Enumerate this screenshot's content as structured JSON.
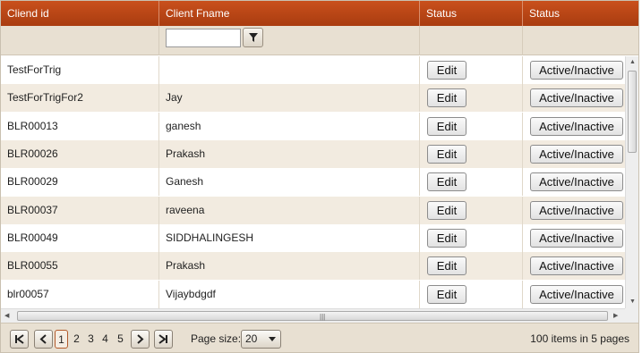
{
  "columns": [
    {
      "label": "Cliend id"
    },
    {
      "label": "Client Fname"
    },
    {
      "label": "Status"
    },
    {
      "label": "Status"
    }
  ],
  "filter": {
    "value": ""
  },
  "icons": {
    "filter": "filter-funnel-icon",
    "first": "first-page-icon",
    "prev": "prev-page-icon",
    "next": "next-page-icon",
    "last": "last-page-icon"
  },
  "rows": [
    {
      "id": "TestForTrig",
      "fname": "",
      "edit": "Edit",
      "status": "Active/Inactive"
    },
    {
      "id": "TestForTrigFor2",
      "fname": "Jay",
      "edit": "Edit",
      "status": "Active/Inactive"
    },
    {
      "id": "BLR00013",
      "fname": "ganesh",
      "edit": "Edit",
      "status": "Active/Inactive"
    },
    {
      "id": "BLR00026",
      "fname": "Prakash",
      "edit": "Edit",
      "status": "Active/Inactive"
    },
    {
      "id": "BLR00029",
      "fname": "Ganesh",
      "edit": "Edit",
      "status": "Active/Inactive"
    },
    {
      "id": "BLR00037",
      "fname": "raveena",
      "edit": "Edit",
      "status": "Active/Inactive"
    },
    {
      "id": "BLR00049",
      "fname": "SIDDHALINGESH",
      "edit": "Edit",
      "status": "Active/Inactive"
    },
    {
      "id": "BLR00055",
      "fname": "Prakash",
      "edit": "Edit",
      "status": "Active/Inactive"
    },
    {
      "id": "blr00057",
      "fname": "Vijaybdgdf",
      "edit": "Edit",
      "status": "Active/Inactive"
    }
  ],
  "pager": {
    "pages": [
      "1",
      "2",
      "3",
      "4",
      "5"
    ],
    "current_page": "1",
    "page_size_label": "Page size:",
    "page_size": "20",
    "info": "100 items in 5 pages"
  },
  "colors": {
    "header": "#b84416",
    "alt_row": "#f2ebe0",
    "toolbar": "#e8e0d2"
  }
}
